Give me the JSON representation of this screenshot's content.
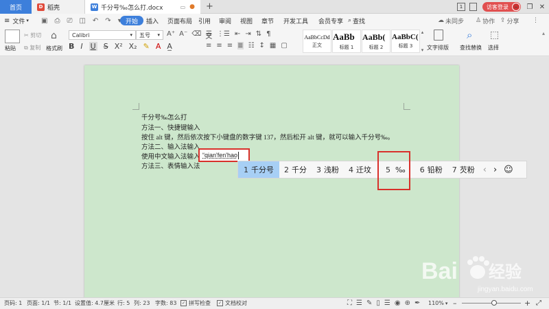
{
  "tabs": {
    "home": "首页",
    "daoke": "稻壳",
    "doc": "千分号‰怎么打.docx",
    "new_tab": "+"
  },
  "titlebar": {
    "login": "访客登录",
    "sync_badge": "1"
  },
  "menu": {
    "file": "文件",
    "items": [
      "开始",
      "插入",
      "页面布局",
      "引用",
      "审阅",
      "视图",
      "章节",
      "开发工具",
      "会员专享"
    ],
    "search": "查找",
    "unsync": "未同步",
    "collab": "协作",
    "share": "分享"
  },
  "ribbon": {
    "paste": "粘贴",
    "cut": "剪切",
    "copy": "复制",
    "format_painter": "格式刷",
    "font": "Calibri",
    "size": "五号",
    "bold": "B",
    "italic": "I",
    "underline": "U",
    "styles": [
      {
        "sample": "AaBbCcDd",
        "name": "正文"
      },
      {
        "sample": "AaBb",
        "name": "标题 1"
      },
      {
        "sample": "AaBb(",
        "name": "标题 2"
      },
      {
        "sample": "AaBbC(",
        "name": "标题 3"
      }
    ],
    "text_layout": "文字排版",
    "find_replace": "查找替换",
    "select": "选择"
  },
  "document": {
    "lines": [
      "千分号‰怎么打",
      "方法一、快捷键输入",
      "按住 alt 键，然后依次按下小键盘的数字键 137，然后松开 alt 键，就可以输入千分号‰。",
      "方法二、输入法输入",
      "使用中文输入法输入",
      "方法三、表情输入法"
    ]
  },
  "ime": {
    "composition": "“qian'fen'hao",
    "candidates": [
      {
        "num": "1",
        "text": "千分号"
      },
      {
        "num": "2",
        "text": "千分"
      },
      {
        "num": "3",
        "text": "浅粉"
      },
      {
        "num": "4",
        "text": "迁坟"
      },
      {
        "num": "5",
        "text": "‰"
      },
      {
        "num": "6",
        "text": "铅粉"
      },
      {
        "num": "7",
        "text": "芡粉"
      }
    ],
    "prev": "‹",
    "next": "›",
    "emoji": "☺"
  },
  "status": {
    "page_num": "页码: 1",
    "page": "页面: 1/1",
    "section": "节: 1/1",
    "position": "设置值: 4.7厘米",
    "row": "行: 5",
    "col": "列: 23",
    "words": "字数: 83",
    "spell": "拼写检查",
    "doc_check": "文档校对",
    "zoom": "110%",
    "zoom_level": 0.55
  },
  "watermark": {
    "brand": "Bai",
    "brand2": "经验",
    "url": "jingyan.baidu.com"
  },
  "colors": {
    "accent": "#3d7fdb",
    "highlight_red": "#d8302a",
    "page_bg": "#cde7cc"
  }
}
